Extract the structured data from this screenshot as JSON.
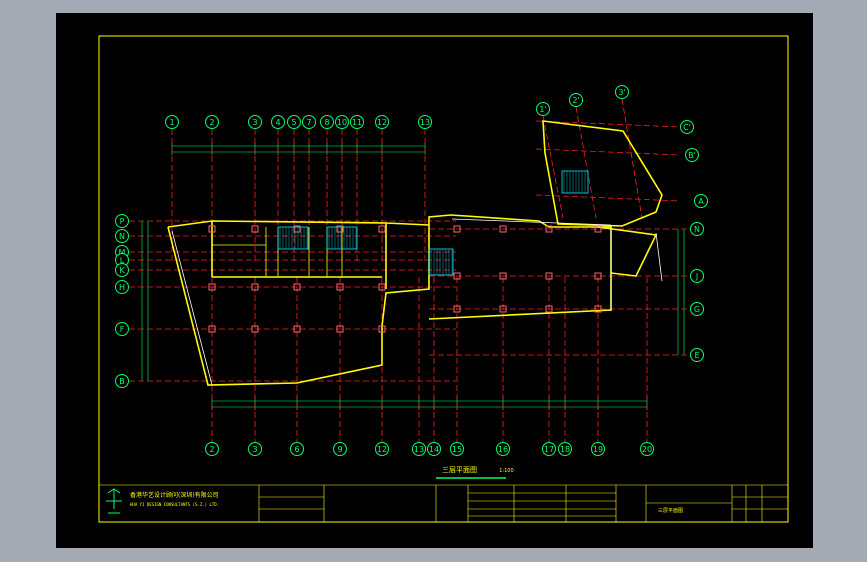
{
  "drawing": {
    "title": "三层平面图",
    "scale": "1:100",
    "company_cn": "香港华艺设计顾问(深圳)有限公司",
    "company_en": "HUA YI DESIGN CONSULTANTS (S.Z.) LTD.",
    "sheet_title": "三层平面图"
  },
  "grid_top": [
    "1",
    "2",
    "3",
    "4",
    "5",
    "7",
    "8",
    "10",
    "11",
    "12",
    "13"
  ],
  "grid_bottom": [
    "2",
    "3",
    "6",
    "9",
    "12",
    "13",
    "14",
    "15",
    "16",
    "17",
    "18",
    "19",
    "20"
  ],
  "grid_left": [
    "P",
    "N",
    "M",
    "L",
    "K",
    "H",
    "F",
    "B"
  ],
  "grid_right": [
    "C'",
    "B'",
    "A",
    "N",
    "J",
    "G",
    "E"
  ],
  "grid_wing": [
    "1'",
    "2'",
    "3'"
  ],
  "colors": {
    "background": "#000000",
    "frame": "#ffff00",
    "grid_line": "#ff2020",
    "grid_bubble": "#00ff66",
    "wall": "#ffff00",
    "column": "#ff6666",
    "stair": "#00e5ff",
    "dimension": "#00ff66",
    "window": "#ffffff"
  }
}
